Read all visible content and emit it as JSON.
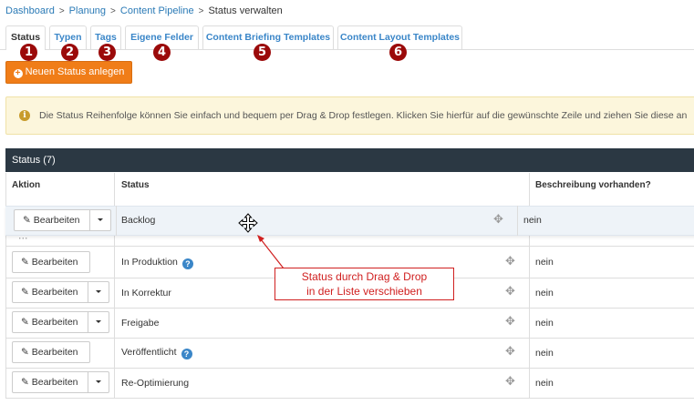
{
  "breadcrumb": {
    "items": [
      "Dashboard",
      "Planung",
      "Content Pipeline"
    ],
    "current": "Status verwalten",
    "separator": ">"
  },
  "tabs": [
    {
      "label": "Status",
      "active": true,
      "badge": "1"
    },
    {
      "label": "Typen",
      "active": false,
      "badge": "2"
    },
    {
      "label": "Tags",
      "active": false,
      "badge": "3"
    },
    {
      "label": "Eigene Felder",
      "active": false,
      "badge": "4"
    },
    {
      "label": "Content Briefing Templates",
      "active": false,
      "badge": "5"
    },
    {
      "label": "Content Layout Templates",
      "active": false,
      "badge": "6"
    }
  ],
  "new_button": {
    "label": "Neuen Status anlegen",
    "icon": "plus-circle-icon"
  },
  "alert": {
    "icon": "info-icon",
    "text": "Die Status Reihenfolge können Sie einfach und bequem per Drag & Drop festlegen. Klicken Sie hierfür auf die gewünschte Zeile und ziehen Sie diese an"
  },
  "panel": {
    "title": "Status (7)"
  },
  "table": {
    "headers": [
      "Aktion",
      "Status",
      "Beschreibung vorhanden?"
    ],
    "edit_label": "Bearbeiten",
    "rows": [
      {
        "status": "Backlog",
        "description": "nein",
        "help": false,
        "dropdown": true,
        "dragging": true
      },
      {
        "status": "In Produktion",
        "description": "nein",
        "help": true,
        "dropdown": false
      },
      {
        "status": "In Korrektur",
        "description": "nein",
        "help": false,
        "dropdown": true
      },
      {
        "status": "Freigabe",
        "description": "nein",
        "help": false,
        "dropdown": true
      },
      {
        "status": "Veröffentlicht",
        "description": "nein",
        "help": true,
        "dropdown": false
      },
      {
        "status": "Re-Optimierung",
        "description": "nein",
        "help": false,
        "dropdown": true
      }
    ]
  },
  "callout": {
    "line1": "Status durch Drag & Drop",
    "line2": "in der Liste verschieben"
  },
  "colors": {
    "accent": "#f07d18",
    "link": "#3a86c8",
    "badge": "#9b0a0a",
    "panel": "#2b3843",
    "callout": "#d02020"
  }
}
